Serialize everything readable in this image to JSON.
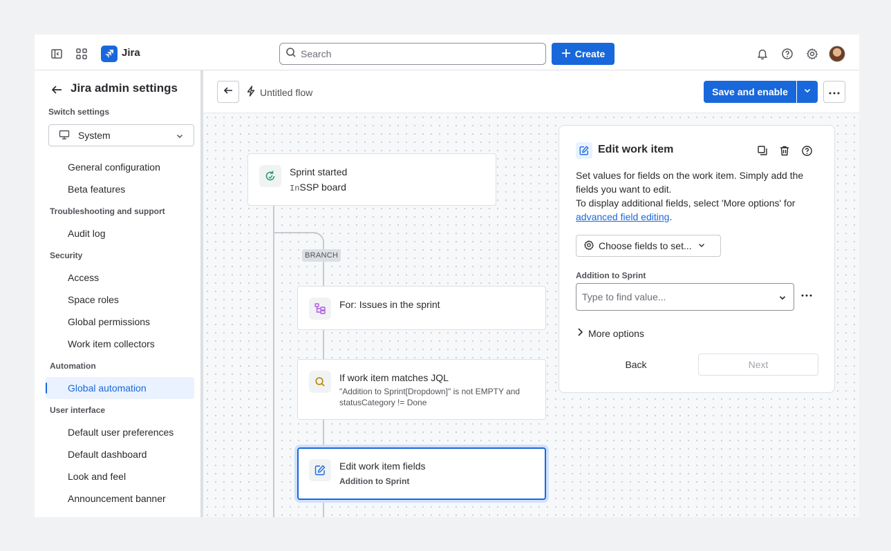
{
  "topnav": {
    "product_name": "Jira",
    "search_placeholder": "Search",
    "create_label": "Create",
    "icons": [
      "sidebar-toggle-icon",
      "app-switcher-icon",
      "bell-icon",
      "help-icon",
      "gear-icon"
    ]
  },
  "sidebar": {
    "title": "Jira admin settings",
    "switch_label": "Switch settings",
    "switch_value": "System",
    "groups": {
      "troubleshooting": "Troubleshooting and support",
      "security": "Security",
      "automation": "Automation",
      "user_interface": "User interface"
    },
    "items": {
      "general_configuration": "General configuration",
      "beta_features": "Beta features",
      "audit_log": "Audit log",
      "access": "Access",
      "space_roles": "Space roles",
      "global_permissions": "Global permissions",
      "work_item_collectors": "Work item collectors",
      "global_automation": "Global automation",
      "default_user_preferences": "Default user preferences",
      "default_dashboard": "Default dashboard",
      "look_and_feel": "Look and feel",
      "announcement_banner": "Announcement banner"
    },
    "active_item": "Global automation"
  },
  "flowbar": {
    "flow_name": "Untitled flow",
    "save_label": "Save and enable"
  },
  "canvas": {
    "trigger": {
      "title": "Sprint started",
      "prefix": "In",
      "board": "SSP board"
    },
    "branch_label": "BRANCH",
    "for_node": {
      "title": "For: Issues in the sprint"
    },
    "jql_node": {
      "title": "If work item matches JQL",
      "desc": "\"Addition to Sprint[Dropdown]\" is not EMPTY and statusCategory != Done"
    },
    "edit_node": {
      "title": "Edit work item fields",
      "sub": "Addition to Sprint"
    }
  },
  "panel": {
    "title": "Edit work item",
    "desc_line1": "Set values for fields on the work item. Simply add the fields you want to edit.",
    "desc_line2": "To display additional fields, select 'More options' for",
    "link_text": "advanced field editing",
    "link_suffix": ".",
    "choose_fields_label": "Choose fields to set...",
    "field_label": "Addition to Sprint",
    "field_placeholder": "Type to find value...",
    "more_options_label": "More options",
    "back_label": "Back",
    "next_label": "Next"
  },
  "colors": {
    "brand": "#1868db",
    "active_bg": "#e9f2fe",
    "trigger_green": "#22a06b",
    "branch_purple": "#af59e1",
    "condition_amber": "#b38600"
  }
}
